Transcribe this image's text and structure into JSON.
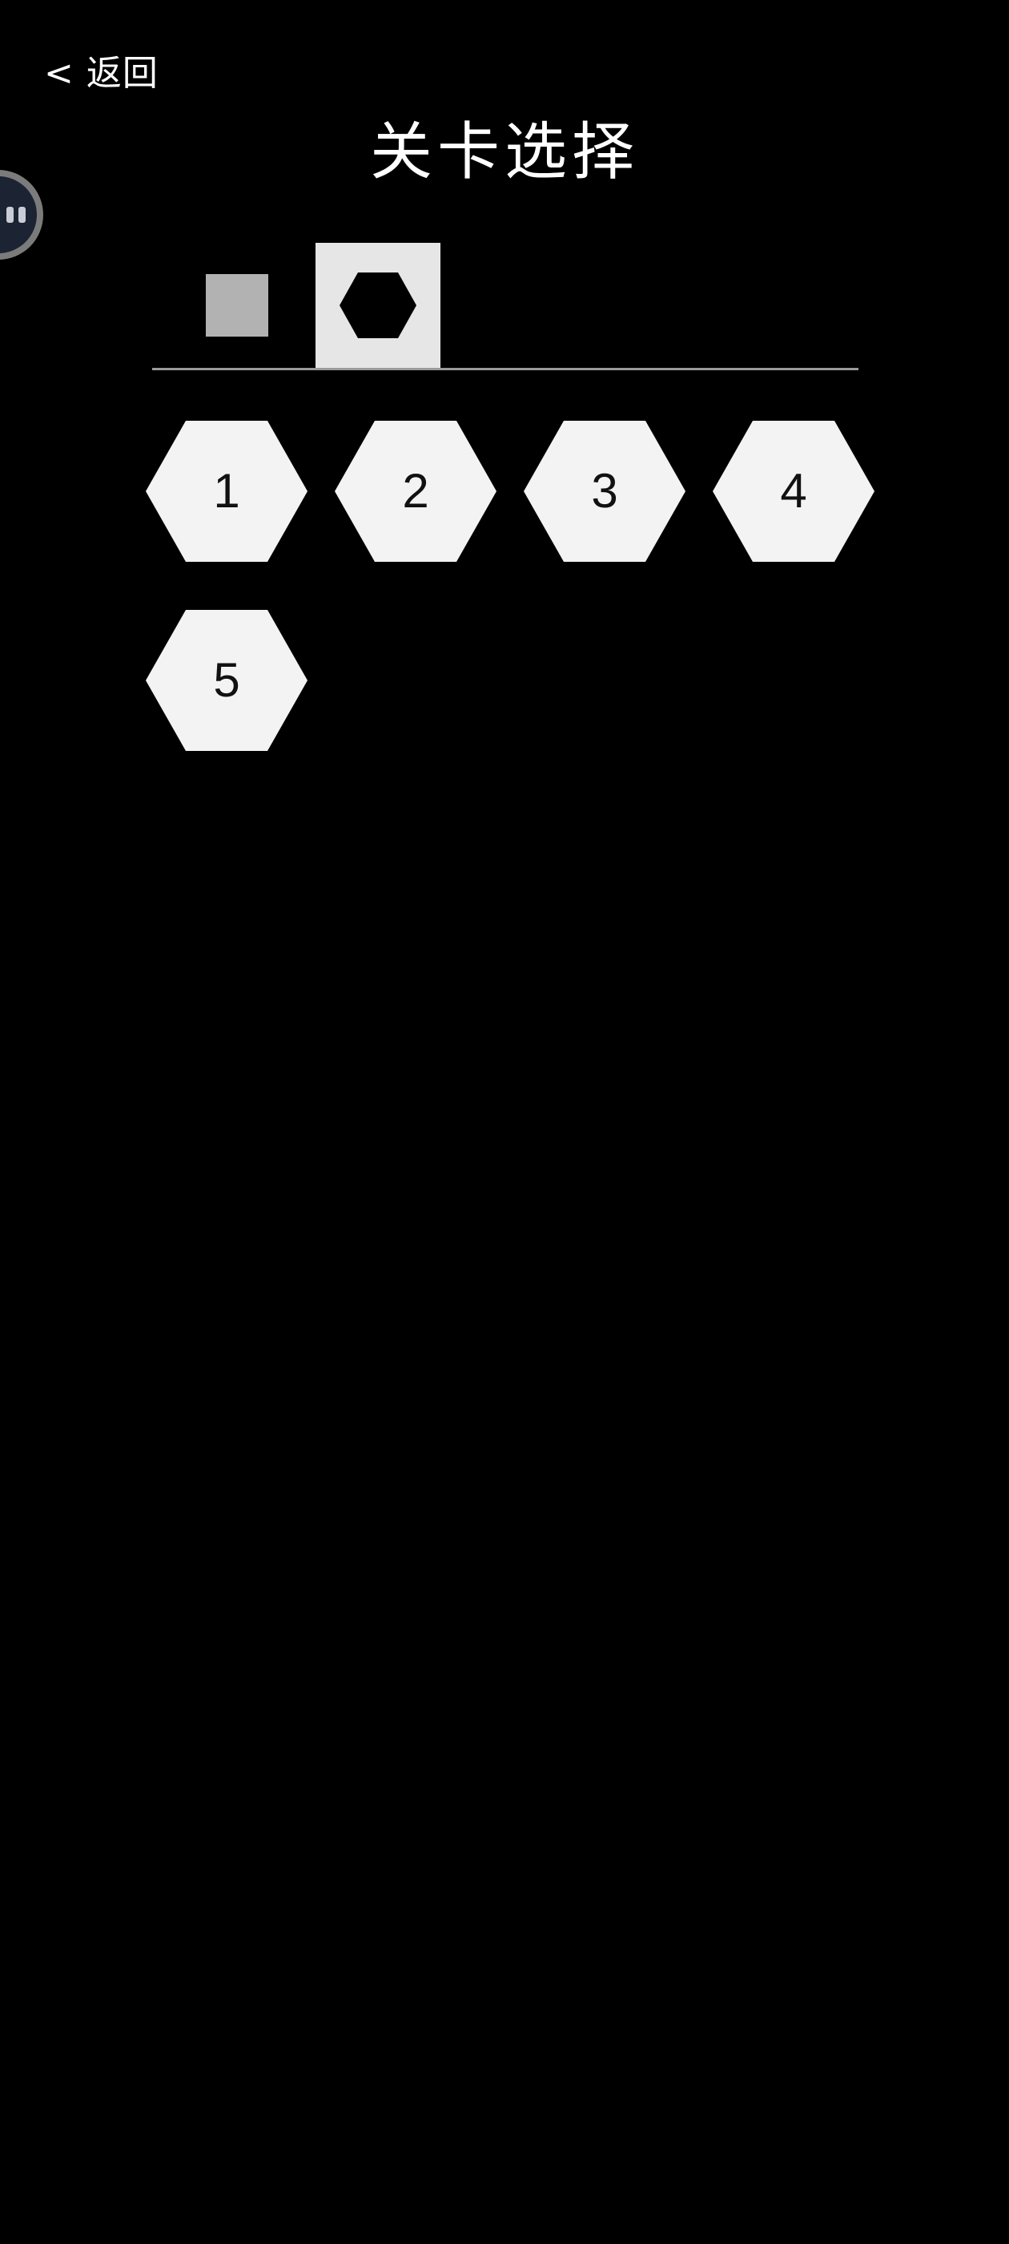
{
  "header": {
    "back_label": "< 返回",
    "title": "关卡选择"
  },
  "floating_assistant": {
    "icon": "assistant-ball-icon"
  },
  "tabs": [
    {
      "name": "square",
      "icon": "square-icon",
      "selected": false
    },
    {
      "name": "hexagon",
      "icon": "hexagon-icon",
      "selected": true
    }
  ],
  "levels": [
    {
      "label": "1"
    },
    {
      "label": "2"
    },
    {
      "label": "3"
    },
    {
      "label": "4"
    },
    {
      "label": "5"
    }
  ],
  "colors": {
    "background": "#000000",
    "text": "#ffffff",
    "level_fill": "#f3f3f3",
    "selected_tab": "#e6e6e6",
    "divider": "#9a9a9a"
  }
}
